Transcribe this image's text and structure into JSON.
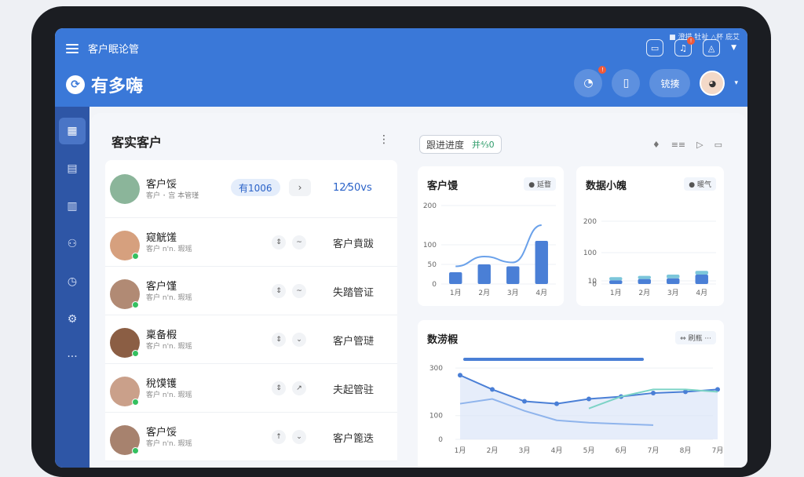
{
  "app": {
    "title": "客户眠论管",
    "brand": "有多嗨",
    "logo_glyph": "⟳",
    "status_text": "■ 澄描 牡祉 △杯 庇艾"
  },
  "top": {
    "bell_badge": "!",
    "action_badge": "!",
    "switch_label": "铳揍"
  },
  "icons": [
    "list-icon",
    "doc-icon",
    "file-icon",
    "user-icon",
    "clock-icon",
    "settings-icon",
    "more-icon"
  ],
  "left": {
    "title": "客实客户",
    "rows": [
      {
        "name": "客户馁",
        "sub": "客户 ･ 宫 本管瑾",
        "tag": "有1006",
        "value": "12⁄50vs"
      },
      {
        "name": "窥觥馐",
        "sub": "客户 n'n. 瑕瑶",
        "status": "客户賁跋",
        "m1": "⇕",
        "m2": "~"
      },
      {
        "name": "客户馑",
        "sub": "客户 n'n. 瑕瑶",
        "status": "失踏管证",
        "m1": "⇕",
        "m2": "~"
      },
      {
        "name": "稟备椵",
        "sub": "客户 n'n. 瑕瑶",
        "status": "客户管琎",
        "m1": "⇕",
        "m2": "⌄"
      },
      {
        "name": "稅馍镬",
        "sub": "客户 n'n. 瑕瑶",
        "status": "夫起管驻",
        "m1": "⇕",
        "m2": "↗"
      },
      {
        "name": "客户馁",
        "sub": "客户 n'n. 瑕瑶",
        "status": "客户篦迭",
        "m1": "↑",
        "m2": "⌄"
      }
    ]
  },
  "right": {
    "seg_label": "跟进进度",
    "seg_badge": "并⁴⁄₃0",
    "card1": {
      "title": "客户馒",
      "badge": "● 延瞀"
    },
    "card2": {
      "title": "数据小魄",
      "badge": "● 暖气"
    },
    "card3": {
      "title": "数涝椵",
      "badge": "⇔ 刷瓶 ···"
    }
  },
  "chart_data": [
    {
      "type": "bar",
      "categories": [
        "1月",
        "2月",
        "3月",
        "4月"
      ],
      "values": [
        30,
        50,
        45,
        110
      ],
      "trend": [
        45,
        70,
        55,
        150
      ],
      "ylim": [
        0,
        200
      ],
      "yticks": [
        0,
        50,
        100,
        200
      ],
      "color": "#4a7fd6"
    },
    {
      "type": "bar",
      "categories": [
        "1月",
        "2月",
        "3月",
        "4月"
      ],
      "values": [
        12,
        16,
        18,
        30
      ],
      "extra": [
        10,
        10,
        12,
        12
      ],
      "ylim": [
        0,
        250
      ],
      "yticks": [
        0,
        10,
        100,
        200
      ],
      "color": "#4a7fd6",
      "color2": "#7cc6da"
    },
    {
      "type": "line",
      "categories": [
        "1月",
        "2月",
        "3月",
        "4月",
        "5月",
        "6月",
        "7月",
        "8月",
        "7月"
      ],
      "yticks": [
        0,
        100,
        300
      ],
      "ylim": [
        0,
        350
      ],
      "series": [
        {
          "values": [
            270,
            210,
            160,
            150,
            170,
            180,
            195,
            200,
            210
          ]
        },
        {
          "values": [
            150,
            170,
            120,
            80,
            70,
            65,
            60
          ]
        },
        {
          "values": [
            null,
            null,
            null,
            null,
            130,
            180,
            210,
            210,
            200
          ]
        }
      ]
    }
  ]
}
